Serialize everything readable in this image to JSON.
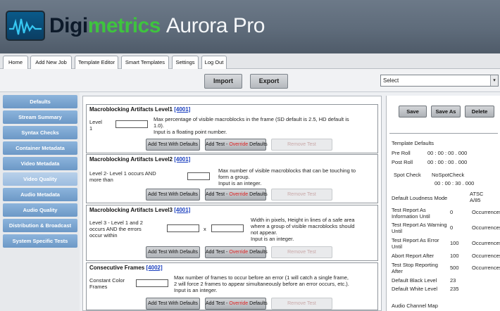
{
  "app": {
    "brand_part1": "Digi",
    "brand_part2": "metrics",
    "brand_part3": "Aurora Pro"
  },
  "nav": {
    "tabs": [
      {
        "label": "Home"
      },
      {
        "label": "Add New Job"
      },
      {
        "label": "Template Editor"
      },
      {
        "label": "Smart Templates"
      },
      {
        "label": "Settings"
      },
      {
        "label": "Log Out"
      }
    ]
  },
  "actions": {
    "import_label": "Import",
    "export_label": "Export",
    "select_value": "Select"
  },
  "sidebar": {
    "items": [
      {
        "label": "Defaults"
      },
      {
        "label": "Stream Summary"
      },
      {
        "label": "Syntax Checks"
      },
      {
        "label": "Container Metadata"
      },
      {
        "label": "Video Metadata"
      },
      {
        "label": "Video Quality"
      },
      {
        "label": "Audio Metadata"
      },
      {
        "label": "Audio Quality"
      },
      {
        "label": "Distribution & Broadcast"
      },
      {
        "label": "System Specific Tests"
      }
    ]
  },
  "panels": [
    {
      "title": "Macroblocking Artifacts Level1",
      "number": "[4001]",
      "label_lines": [
        "Level",
        "1"
      ],
      "desc_lines": [
        "Max percentage of visible macroblocks in the frame (SD default is 2.5, HD default is",
        "1.0).",
        "Input is a floating point number."
      ]
    },
    {
      "title": "Macroblocking Artifacts Level2",
      "number": "[4001]",
      "label_lines": [
        "Level 2- Level 1 occurs AND",
        "more than"
      ],
      "desc_lines": [
        "Max number of visible macroblocks that can be touching to",
        "form a group.",
        "Input is an integer."
      ]
    },
    {
      "title": "Macroblocking Artifacts Level3",
      "number": "[4001]",
      "label_lines": [
        "Level 3 - Level 1 and 2",
        "occurs AND the errors",
        "occur within"
      ],
      "x_label": "x",
      "desc_lines": [
        "Width in pixels, Height in lines of a safe area",
        "where a group of visible macroblocks should",
        "not appear.",
        "Input is an integer."
      ]
    },
    {
      "title": "Consecutive Frames",
      "number": "[4002]",
      "label_lines": [
        "Constant Color",
        "Frames"
      ],
      "desc_lines": [
        "Max number of frames to occur before an error (1 will catch a single frame,",
        "2 will force 2 frames to appear simultaneously before an error occurs, etc.).",
        "Input is an integer."
      ]
    }
  ],
  "panel_buttons": {
    "add_defaults": "Add Test With Defaults",
    "add_override_prefix": "Add Test - ",
    "add_override_red": "Override",
    "add_override_suffix": " Defaults",
    "remove_prefix": "Remove",
    "remove_suffix": " Test"
  },
  "right": {
    "save": "Save",
    "save_as": "Save As",
    "delete": "Delete",
    "template_defaults": "Template Defaults",
    "pre_roll_label": "Pre Roll",
    "pre_roll_value": "00 : 00 : 00 . 000",
    "post_roll_label": "Post Roll",
    "post_roll_value": "00 : 00 : 00 . 000",
    "spot_check_label": "Spot Check",
    "spot_check_value": "NoSpotCheck",
    "spot_check_time": "00 : 00 : 30 . 000",
    "loudness_label": "Default Loudness Mode",
    "loudness_value_1": "ATSC",
    "loudness_value_2": "A/85",
    "rows": [
      {
        "label_1": "Test     Report     As",
        "label_2": "Information Until",
        "value": "0",
        "unit": "Occurrences"
      },
      {
        "label_1": "Test Report As Warning",
        "label_2": "Until",
        "value": "0",
        "unit": "Occurrences"
      },
      {
        "label_1": "Test   Report   As   Error",
        "label_2": "Until",
        "value": "100",
        "unit": "Occurrences"
      },
      {
        "label_1": "Abort Report After",
        "label_2": "",
        "value": "100",
        "unit": "Occurrences"
      },
      {
        "label_1": "Test    Stop    Reporting",
        "label_2": "After",
        "value": "500",
        "unit": "Occurrences"
      }
    ],
    "black_level_label": "Default Black Level",
    "black_level_value": "23",
    "white_level_label": "Default White Level",
    "white_level_value": "235",
    "audio_map_label": "Audio Channel Map"
  },
  "colors": {
    "brand_green": "#3ec43e",
    "sidebar_blue": "#7aa6d3",
    "link_blue": "#1a3fbf",
    "override_red": "#dd2222"
  }
}
